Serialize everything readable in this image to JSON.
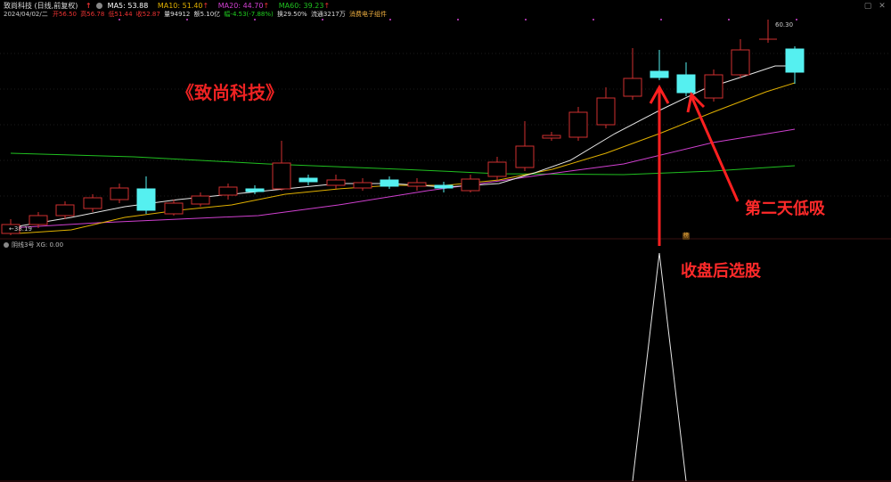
{
  "header": {
    "stock_title": "致尚科技 (日线,前复权)",
    "ma5": "MA5: 53.88",
    "ma10": "MA10: 51.40",
    "ma20": "MA20: 44.70",
    "ma60": "MA60: 39.23",
    "date": "2024/04/02/二",
    "open": "开56.50",
    "high": "高56.78",
    "low": "低51.44",
    "close": "收52.87",
    "volume": "量94912",
    "amount": "额5.10亿",
    "change": "幅-4.53(-7.88%)",
    "turnover": "换29.50%",
    "float": "流通3217万",
    "concept": "消费电子组件",
    "up_arrow": "↑",
    "dot_marker": "●",
    "colors": {
      "ma5": "#ffffff",
      "ma10": "#f0c000",
      "ma20": "#e040e0",
      "ma60": "#20c020"
    }
  },
  "chart": {
    "overlay_title": "《致尚科技》",
    "low_label": "38.19",
    "high_label": "60.30",
    "annotation_dip": "第二天低吸",
    "annotation_select": "收盘后选股",
    "badge": "榜",
    "colors": {
      "up": "#e03030",
      "down": "#55f0f0",
      "arrow": "#ff2020"
    }
  },
  "indicator": {
    "label": "阴线3号  XG: 0.00"
  },
  "window": {
    "restore": "▢",
    "close": "✕"
  }
}
